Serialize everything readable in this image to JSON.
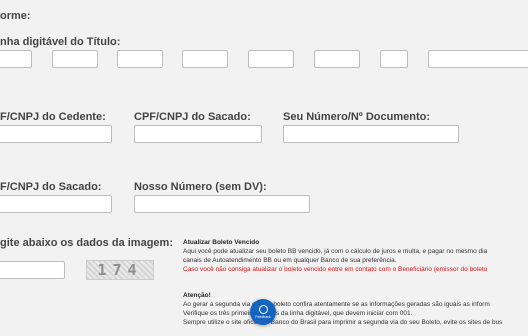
{
  "labels": {
    "form_header": "orme:",
    "linha_digitavel": "nha digitável do Título:",
    "cpf_cedente": "F/CNPJ do Cedente:",
    "cpf_sacado": "CPF/CNPJ do Sacado:",
    "seu_numero": "Seu Número/Nº Documento:",
    "cpf_sacado_2": "F/CNPJ do Sacado:",
    "nosso_numero": "Nosso Número (sem DV):",
    "captcha_prompt": "gite abaixo os dados da imagem:"
  },
  "fields": {
    "linha": [
      "",
      "",
      "",
      "",
      "",
      "",
      "",
      ""
    ],
    "cpf_cedente": "",
    "cpf_sacado": "",
    "seu_numero": "",
    "cpf_sacado_2": "",
    "nosso_numero": "",
    "captcha_input": ""
  },
  "captcha": {
    "text": "174"
  },
  "info": {
    "title": "Atualizar Boleto Vencido",
    "line1": "Aqui você pode atualizar seu boleto BB vencido, já com o cálculo de juros e multa, e pagar no mesmo dia",
    "line2": "canais de Autoatendimento BB ou em qualquer Banco de sua preferência.",
    "warning": "Caso você não consiga atualizar o boleto vencido entre em contato com o Beneficiário (emissor do boleto",
    "attention_title": "Atenção!",
    "att1": "Ao gerar a segunda via do seu boleto confira atentamente se as informações geradas são iguais as inform",
    "att2": "Verifique os três primeiros dígitos da linha digitável, que devem iniciar com 001.",
    "att3": "Sempre utilize o site oficial do Banco do Brasil para imprimir a segunda via do seu Boleto, evite os sites de bus"
  },
  "badge": {
    "label": "Feedback"
  }
}
